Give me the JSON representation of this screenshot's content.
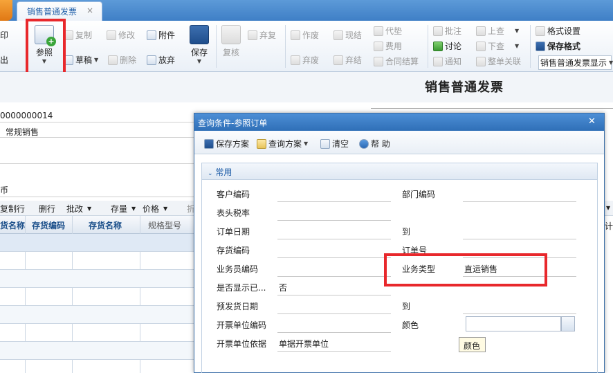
{
  "tab": {
    "label": "销售普通发票",
    "close": "×"
  },
  "toolbar": {
    "print": "打印",
    "export": "输出",
    "reference": "参照",
    "copy": "复制",
    "draft": "草稿",
    "modify": "修改",
    "delete": "删除",
    "attachment": "附件",
    "abandon_edit": "放弃",
    "save": "保存",
    "review": "复核",
    "abandon_review": "弃复",
    "void": "作废",
    "discard": "弃废",
    "cash_settle": "现结",
    "discard_settle": "弃结",
    "advance_pay": "代垫",
    "expense": "费用",
    "contract_settle": "合同结算",
    "annotate": "批注",
    "discuss": "讨论",
    "notify": "通知",
    "prev": "上查",
    "next": "下查",
    "link_all": "整单关联",
    "format_settings": "格式设置",
    "save_format": "保存格式",
    "format_select": "销售普通发票显示"
  },
  "form": {
    "title": "销售普通发票",
    "invoice_no": "0000000014",
    "business_type": "常规销售",
    "currency": "币"
  },
  "grid_toolbar": {
    "copy_row": "复制行",
    "delete_row": "删行",
    "batch_modify": "批改",
    "stock": "存量",
    "price": "价格",
    "more": "折",
    "right_more": "▾"
  },
  "grid": {
    "headers": [
      "货名称",
      "存货编码",
      "存货名称",
      "规格型号"
    ],
    "right_header": "计"
  },
  "dialog": {
    "title": "查询条件-参照订单",
    "close": "✕",
    "tools": {
      "save_scheme": "保存方案",
      "query_scheme": "查询方案",
      "clear": "清空",
      "help": "帮 助"
    },
    "section": "常用",
    "fields": {
      "customer_code": "客户编码",
      "dept_code": "部门编码",
      "tax_rate": "表头税率",
      "order_date": "订单日期",
      "to1": "到",
      "stock_code": "存货编码",
      "order_no": "订单号",
      "salesman_code": "业务员编码",
      "business_type": "业务类型",
      "business_type_value": "直运销售",
      "show_completed": "是否显示已...",
      "show_completed_value": "否",
      "ship_date": "预发货日期",
      "to2": "到",
      "invoice_unit_code": "开票单位编码",
      "color": "颜色",
      "invoice_unit_basis": "开票单位依据",
      "invoice_unit_basis_value": "单据开票单位"
    },
    "tooltip": "颜色"
  }
}
